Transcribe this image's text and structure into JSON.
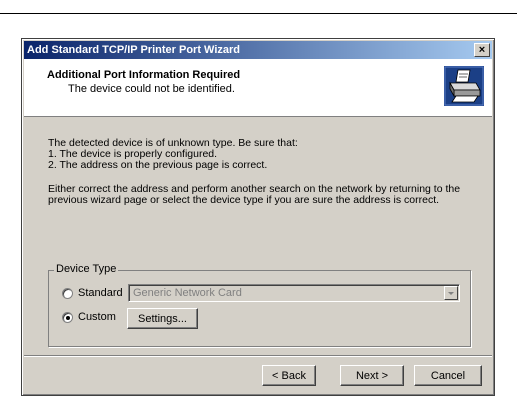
{
  "window": {
    "title": "Add Standard TCP/IP Printer Port Wizard",
    "close_label": "×"
  },
  "header": {
    "title": "Additional Port Information Required",
    "subtitle": "The device could not be identified.",
    "icon": "printer-icon"
  },
  "body": {
    "line1": "The detected device is of unknown type.  Be sure that:",
    "line2": "1. The device is properly configured.",
    "line3": "2. The address on the previous page is correct.",
    "para2_line1": "Either correct the address and perform another search on the network by returning to the",
    "para2_line2": "previous wizard page or select the device type if you are sure the address is correct."
  },
  "device_type": {
    "group_label": "Device Type",
    "standard_label": "Standard",
    "standard_selected": false,
    "standard_value": "Generic Network Card",
    "custom_label": "Custom",
    "custom_selected": true,
    "settings_label": "Settings..."
  },
  "footer": {
    "back_label": "< Back",
    "next_label": "Next >",
    "cancel_label": "Cancel"
  }
}
